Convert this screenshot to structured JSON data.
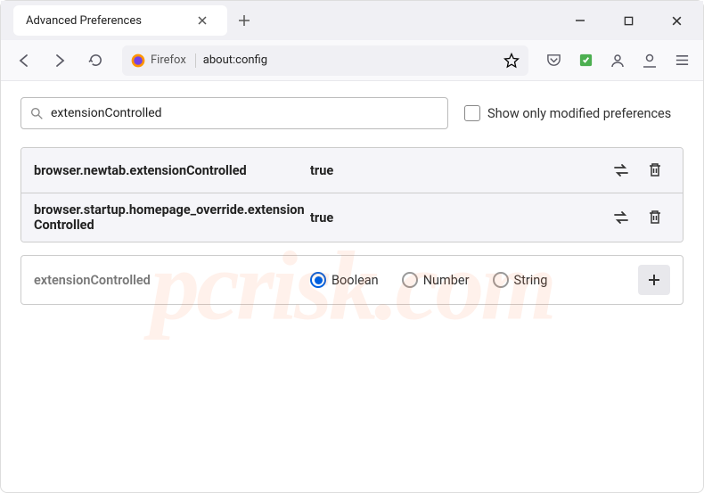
{
  "tab": {
    "title": "Advanced Preferences"
  },
  "addressbar": {
    "brand": "Firefox",
    "url": "about:config"
  },
  "search": {
    "value": "extensionControlled"
  },
  "showOnlyModified": {
    "label": "Show only modified preferences"
  },
  "prefs": [
    {
      "name": "browser.newtab.extensionControlled",
      "value": "true"
    },
    {
      "name": "browser.startup.homepage_override.extensionControlled",
      "value": "true"
    }
  ],
  "addRow": {
    "name": "extensionControlled",
    "types": {
      "boolean": "Boolean",
      "number": "Number",
      "string": "String"
    }
  },
  "watermark": "pcrisk.com"
}
